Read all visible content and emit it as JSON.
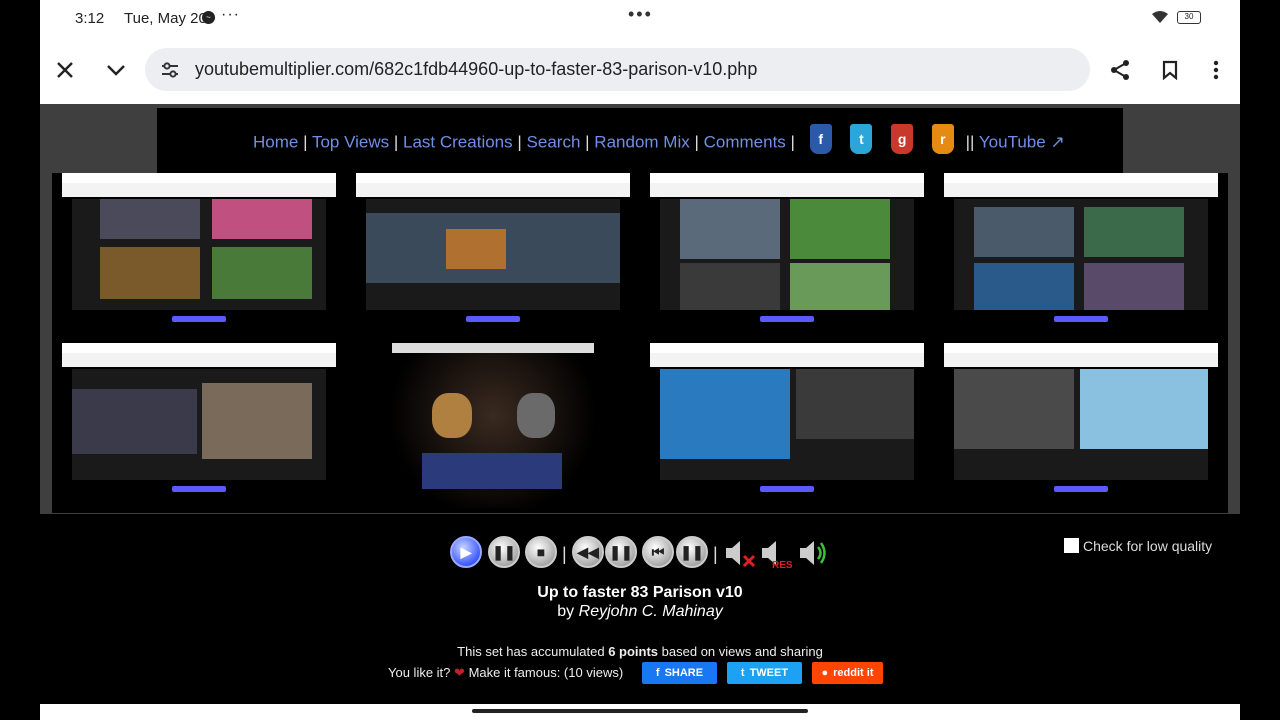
{
  "status": {
    "time": "3:12",
    "date": "Tue, May 20",
    "more": "···",
    "battery": "30"
  },
  "browser": {
    "url": "youtubemultiplier.com/682c1fdb44960-up-to-faster-83-parison-v10.php",
    "icons": [
      "close-icon",
      "chevron-down-icon",
      "site-settings-icon",
      "share-icon",
      "bookmark-icon",
      "more-vert-icon"
    ]
  },
  "nav": {
    "links": [
      "Home",
      "Top Views",
      "Last Creations",
      "Search",
      "Random Mix",
      "Comments"
    ],
    "separator": "|",
    "social": [
      {
        "name": "facebook",
        "glyph": "f",
        "color": "#2b5aa8"
      },
      {
        "name": "twitter",
        "glyph": "t",
        "color": "#2aa6d8"
      },
      {
        "name": "google-plus",
        "glyph": "g",
        "color": "#c9392b"
      },
      {
        "name": "rss",
        "glyph": "r",
        "color": "#e58b13"
      }
    ],
    "double_sep": "||",
    "youtube_label": "YouTube"
  },
  "player": {
    "low_quality_label": "Check for low quality",
    "title": "Up to faster 83 Parison v10",
    "by": "by",
    "author": "Reyjohn C. Mahinay",
    "points_prefix": "This set has accumulated",
    "points_value": "6 points",
    "points_suffix": "based on views and sharing",
    "like_prefix": "You like it?",
    "like_suffix": "Make it famous: (10 views)",
    "share_fb": "SHARE",
    "share_tw": "TWEET",
    "share_reddit": "reddit it",
    "colors": {
      "facebook": "#1877f2",
      "twitter": "#1da1f2",
      "reddit": "#ff4500"
    }
  }
}
